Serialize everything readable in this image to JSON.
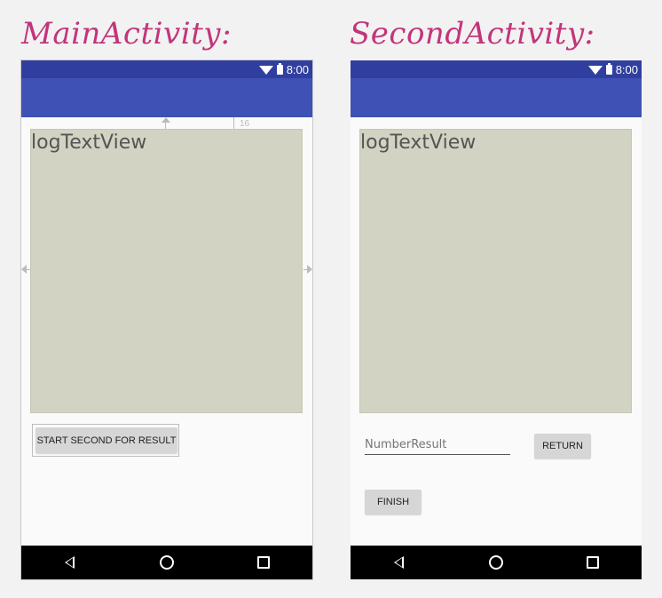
{
  "captions": {
    "main": "MainActivity:",
    "second": "SecondActivity:"
  },
  "main_activity": {
    "status_time": "8:00",
    "log_text": "logTextView",
    "start_button": "START SECOND FOR RESULT",
    "guide_margin_label": "16"
  },
  "second_activity": {
    "status_time": "8:00",
    "log_text": "logTextView",
    "number_input_placeholder": "NumberResult",
    "return_button": "RETURN",
    "finish_button": "FINISH"
  },
  "colors": {
    "status_bar": "#303f9f",
    "app_bar": "#3f51b5",
    "log_background": "#d3d3c3",
    "caption": "#c2357a"
  },
  "icons": [
    "wifi-icon",
    "battery-icon",
    "back-icon",
    "home-icon",
    "recents-icon"
  ]
}
